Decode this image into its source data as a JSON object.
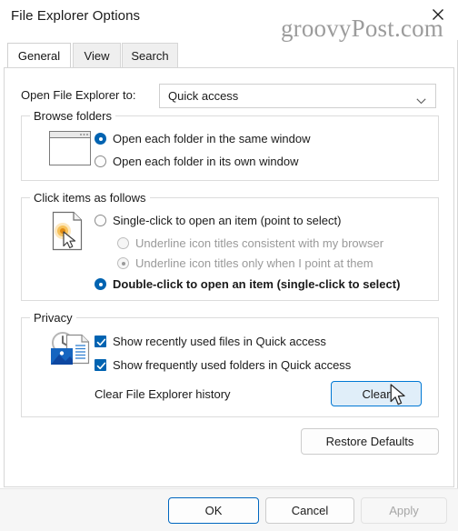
{
  "window": {
    "title": "File Explorer Options",
    "close_icon": "close-icon",
    "watermark": "groovyPost.com"
  },
  "tabs": [
    {
      "label": "General",
      "selected": true
    },
    {
      "label": "View",
      "selected": false
    },
    {
      "label": "Search",
      "selected": false
    }
  ],
  "general": {
    "open_to": {
      "label": "Open File Explorer to:",
      "value": "Quick access",
      "arrow_icon": "chevron-down-icon"
    },
    "browse_folders": {
      "title": "Browse folders",
      "icon": "window-preview-icon",
      "options": [
        {
          "label": "Open each folder in the same window",
          "selected": true
        },
        {
          "label": "Open each folder in its own window",
          "selected": false
        }
      ]
    },
    "click_items": {
      "title": "Click items as follows",
      "icon": "document-click-icon",
      "options": [
        {
          "label": "Single-click to open an item (point to select)",
          "selected": false,
          "disabled": false,
          "bold": false
        },
        {
          "label": "Underline icon titles consistent with my browser",
          "selected": false,
          "disabled": true,
          "bold": false
        },
        {
          "label": "Underline icon titles only when I point at them",
          "selected": true,
          "disabled": true,
          "bold": false
        },
        {
          "label": "Double-click to open an item (single-click to select)",
          "selected": true,
          "disabled": false,
          "bold": true
        }
      ]
    },
    "privacy": {
      "title": "Privacy",
      "icon": "history-files-icon",
      "checkboxes": [
        {
          "label": "Show recently used files in Quick access",
          "checked": true
        },
        {
          "label": "Show frequently used folders in Quick access",
          "checked": true
        }
      ],
      "clear_history_label": "Clear File Explorer history",
      "clear_button": "Clear"
    },
    "restore_defaults_button": "Restore Defaults"
  },
  "footer": {
    "ok_button": "OK",
    "cancel_button": "Cancel",
    "apply_button": "Apply"
  },
  "colors": {
    "accent": "#0063b1",
    "default_button_border": "#0067c0",
    "hover_fill": "#e0eef9",
    "hover_border": "#0078d4",
    "disabled_text": "#9a9a9a"
  }
}
